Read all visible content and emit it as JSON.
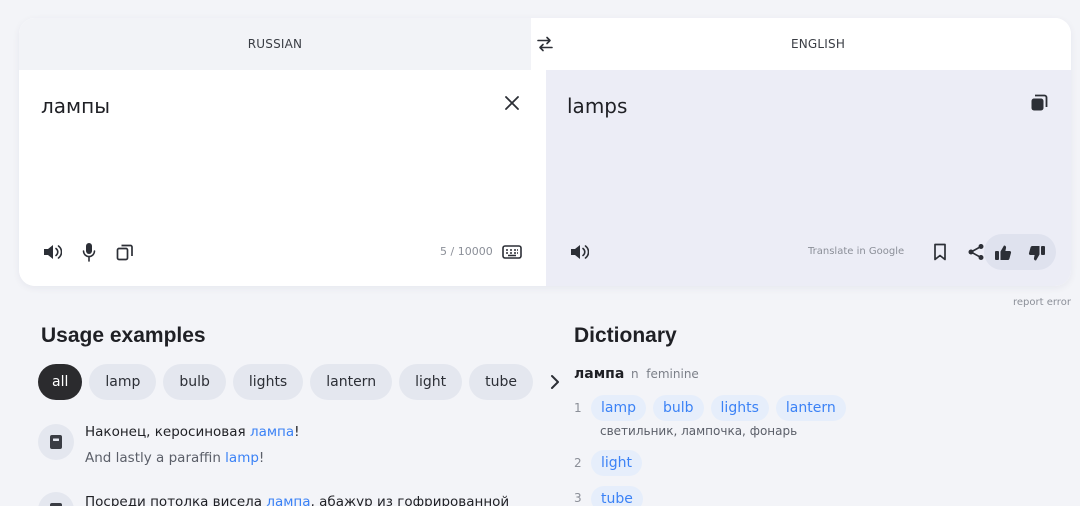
{
  "translator": {
    "source_lang": "RUSSIAN",
    "target_lang": "ENGLISH",
    "source_text": "лампы",
    "target_text": "lamps",
    "char_counter": "5 / 10000",
    "translate_in_google": "Translate in Google",
    "report_error": "report error"
  },
  "icons": {
    "swap": "swap-arrows-icon",
    "clear": "close-icon",
    "copy": "copy-icon",
    "speaker": "speaker-icon",
    "mic": "microphone-icon",
    "keyboard": "keyboard-icon",
    "bookmark": "bookmark-icon",
    "share": "share-icon",
    "like": "thumbs-up-icon",
    "dislike": "thumbs-down-icon",
    "chevron": "chevron-right-icon",
    "example": "book-icon"
  },
  "usage": {
    "title": "Usage examples",
    "filters": [
      "all",
      "lamp",
      "bulb",
      "lights",
      "lantern",
      "light",
      "tube"
    ],
    "examples": [
      {
        "src_before": "Наконец, керосиновая ",
        "src_hl": "лампа",
        "src_after": "!",
        "tr_before": "And lastly a paraffin ",
        "tr_hl": "lamp",
        "tr_after": "!"
      },
      {
        "src_before": "Посреди потолка висела ",
        "src_hl": "лампа",
        "src_after": ", абажур из гофрированной",
        "tr_before": "",
        "tr_hl": "",
        "tr_after": ""
      }
    ]
  },
  "dictionary": {
    "title": "Dictionary",
    "lemma": "лампа",
    "pos": "n",
    "gender": "feminine",
    "senses": [
      {
        "num": "1",
        "translations": [
          "lamp",
          "bulb",
          "lights",
          "lantern"
        ],
        "synonyms": "светильник, лампочка, фонарь"
      },
      {
        "num": "2",
        "translations": [
          "light"
        ],
        "synonyms": ""
      },
      {
        "num": "3",
        "translations": [
          "tube"
        ],
        "synonyms": ""
      }
    ]
  },
  "colors": {
    "accent": "#3b82f6",
    "active_chip": "#2b2b2e",
    "target_pane": "#ecedf6"
  }
}
